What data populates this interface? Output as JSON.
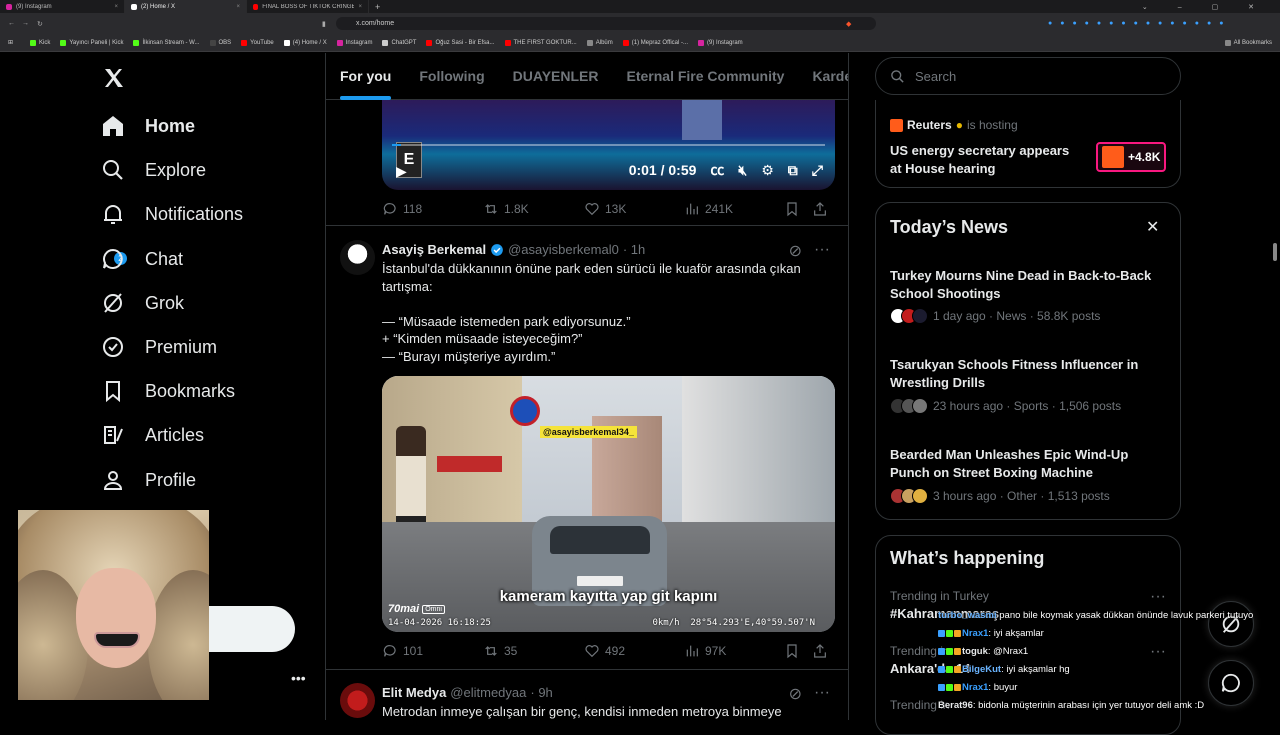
{
  "browser": {
    "tabs": [
      {
        "title": "(9) Instagram",
        "color": "#d6249f"
      },
      {
        "title": "(2) Home / X",
        "color": "#ffffff",
        "active": true
      },
      {
        "title": "FINAL BOSS OF TIKTOK CRINGE - Yo",
        "color": "#ff0000"
      }
    ],
    "url": "x.com/home",
    "bookmarks": [
      "Kick",
      "Yayıncı Paneli | Kick",
      "İlkinsan Stream - W...",
      "OBS",
      "YouTube",
      "(4) Home / X",
      "Instagram",
      "ChatGPT",
      "Oğuz Sasi - Bir Efsa...",
      "THE FIRST GOKTUR...",
      "Albüm",
      "(1) Mepraz Offical -...",
      "(9) Instagram"
    ],
    "all_bookmarks": "All Bookmarks"
  },
  "sidebar": {
    "items": [
      {
        "label": "Home",
        "icon": "home-icon"
      },
      {
        "label": "Explore",
        "icon": "search-icon"
      },
      {
        "label": "Notifications",
        "icon": "bell-icon"
      },
      {
        "label": "Chat",
        "icon": "chat-icon"
      },
      {
        "label": "Grok",
        "icon": "grok-icon"
      },
      {
        "label": "Premium",
        "icon": "premium-icon"
      },
      {
        "label": "Bookmarks",
        "icon": "bookmark-icon"
      },
      {
        "label": "Articles",
        "icon": "articles-icon"
      },
      {
        "label": "Profile",
        "icon": "profile-icon"
      }
    ],
    "notification_count": "2"
  },
  "feed": {
    "tabs": [
      "For you",
      "Following",
      "DUAYENLER",
      "Eternal Fire Community",
      "Kardeşler Ku"
    ],
    "video": {
      "time": "0:01 / 0:59",
      "progress": 0.02,
      "rating": "E"
    },
    "post1_actions": {
      "replies": "118",
      "reposts": "1.8K",
      "likes": "13K",
      "views": "241K"
    },
    "post2": {
      "name": "Asayiş Berkemal",
      "handle": "@asayisberkemal0",
      "time": "· 1h",
      "text_lines": [
        "İstanbul'da dükkanının önüne park eden sürücü ile kuaför arasında çıkan",
        "tartışma:",
        "",
        "— “Müsaade istemeden park ediyorsunuz.”",
        "+ “Kimden müsaade isteyeceğim?”",
        "— “Burayı müşteriye ayırdım.”"
      ],
      "image": {
        "watermark": "@asayisberkemal34_",
        "subtitle": "kameram kayıtta yap git kapını",
        "brand": "70mai",
        "brand_tag": "Omni",
        "datetime": "14-04-2026  16:18:25",
        "speed": "0km/h",
        "coords": "28°54.293'E,40°59.507'N"
      },
      "actions": {
        "replies": "101",
        "reposts": "35",
        "likes": "492",
        "views": "97K"
      }
    },
    "post3": {
      "name": "Elit Medya",
      "handle": "@elitmedyaa",
      "time": "· 9h",
      "text": "Metrodan inmeye çalışan bir genç, kendisi inmeden metroya binmeye"
    }
  },
  "right": {
    "search_placeholder": "Search",
    "live": {
      "host": "Reuters",
      "hosting_label": "is hosting",
      "title_lines": [
        "US energy secretary appears",
        "at House hearing"
      ],
      "listeners": "+4.8K"
    },
    "news": {
      "title": "Today’s News",
      "items": [
        {
          "headline": [
            "Turkey Mourns Nine Dead in Back-to-Back",
            "School Shootings"
          ],
          "meta": "1 day ago · News · 58.8K posts"
        },
        {
          "headline": [
            "Tsarukyan Schools Fitness Influencer in",
            "Wrestling Drills"
          ],
          "meta": "23 hours ago · Sports · 1,506 posts"
        },
        {
          "headline": [
            "Bearded Man Unleashes Epic Wind-Up",
            "Punch on Street Boxing Machine"
          ],
          "meta": "3 hours ago · Other · 1,513 posts"
        }
      ]
    },
    "happening": {
      "title": "What’s happening",
      "trends": [
        {
          "context": "Trending in Turkey",
          "name": "#Kahramanmaraş"
        },
        {
          "context": "Trending in",
          "name": "Ankara'da 14"
        },
        {
          "context": "Trending in",
          "name": ""
        }
      ]
    }
  },
  "chat_overlay": [
    {
      "user": "turbo_wasmi",
      "text": "pano bile koymak yasak dükkan önünde lavuk parkeri tutuyo"
    },
    {
      "user": "Nrax1",
      "text": ": iyi akşamlar"
    },
    {
      "user": "toguk",
      "text": ": @Nrax1"
    },
    {
      "user": "BilgeKut",
      "text": ": iyi akşamlar hg"
    },
    {
      "user": "Nrax1",
      "text": ": buyur"
    },
    {
      "user": "Berat96",
      "text": ": bidonla müşterinin arabası için yer tutuyor deli amk :D"
    }
  ],
  "colors": {
    "accent": "#1d9bf0",
    "live": "#f91880",
    "bg": "#000000",
    "border": "#2f3336"
  }
}
